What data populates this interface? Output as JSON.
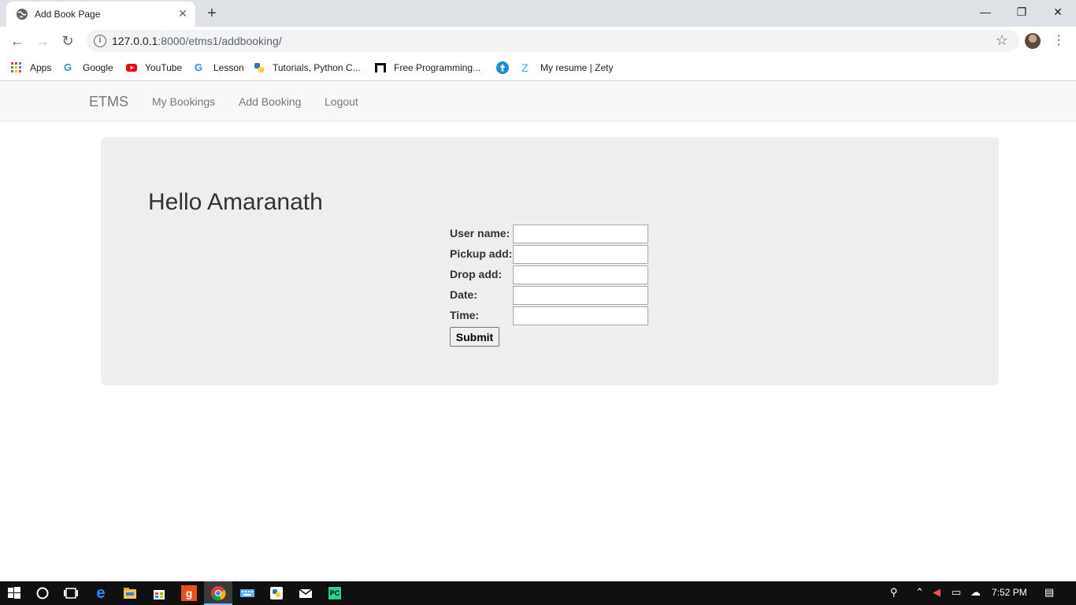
{
  "browser": {
    "tab_title": "Add Book Page",
    "url_host": "127.0.0.1",
    "url_path": ":8000/etms1/addbooking/",
    "bookmarks": [
      "Apps",
      "Google",
      "YouTube",
      "Lesson",
      "Tutorials, Python C...",
      "Free Programming...",
      "My resume | Zety"
    ]
  },
  "nav": {
    "brand": "ETMS",
    "links": [
      "My Bookings",
      "Add Booking",
      "Logout"
    ]
  },
  "main": {
    "greeting": "Hello Amaranath",
    "fields": [
      {
        "label": "User name:",
        "value": ""
      },
      {
        "label": "Pickup add:",
        "value": ""
      },
      {
        "label": "Drop add:",
        "value": ""
      },
      {
        "label": "Date:",
        "value": ""
      },
      {
        "label": "Time:",
        "value": ""
      }
    ],
    "submit_label": "Submit"
  },
  "taskbar": {
    "time": "7:52 PM"
  },
  "colors": {
    "jumbotron_bg": "#eeeeee",
    "navbar_bg": "#f8f8f8",
    "chrome_tabstrip": "#dee1e6"
  }
}
